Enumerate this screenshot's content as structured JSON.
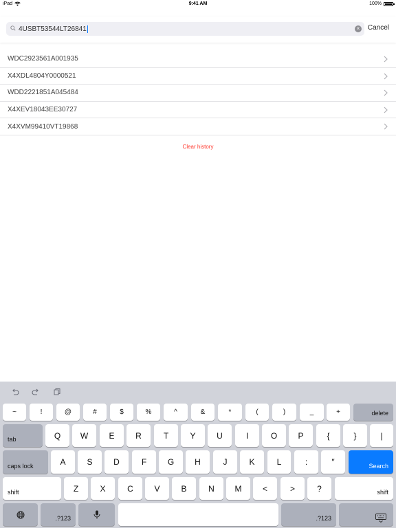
{
  "status_bar": {
    "device": "iPad",
    "time": "9:41 AM",
    "battery": "100%",
    "icons": [
      "wifi-icon",
      "battery-icon"
    ]
  },
  "search": {
    "value": "4USBT53544LT26841",
    "icon": "search-icon",
    "clear_icon": "clear-icon",
    "cancel_label": "Cancel"
  },
  "history": {
    "items": [
      {
        "label": "WDC2923561A001935"
      },
      {
        "label": "X4XDL4804Y0000521"
      },
      {
        "label": "WDD2221851A045484"
      },
      {
        "label": "X4XEV18043EE30727"
      },
      {
        "label": "X4XVM99410VT19868"
      }
    ],
    "clear_label": "Clear history",
    "accent_color": "#ff3b30"
  },
  "keyboard": {
    "toolbar_icons": [
      "undo-icon",
      "redo-icon",
      "paste-icon"
    ],
    "row1": [
      "~",
      "!",
      "@",
      "#",
      "$",
      "%",
      "^",
      "&",
      "*",
      "(",
      ")",
      "_",
      "+"
    ],
    "delete_label": "delete",
    "tab_label": "tab",
    "row2": [
      "Q",
      "W",
      "E",
      "R",
      "T",
      "Y",
      "U",
      "I",
      "O",
      "P",
      "{",
      "}",
      "|"
    ],
    "caps_label": "caps lock",
    "row3": [
      "A",
      "S",
      "D",
      "F",
      "G",
      "H",
      "J",
      "K",
      "L",
      ":",
      "″"
    ],
    "search_label": "Search",
    "search_color": "#0a7bff",
    "shift_label": "shift",
    "row4": [
      "Z",
      "X",
      "C",
      "V",
      "B",
      "N",
      "M",
      "<",
      ">",
      "?"
    ],
    "numbers_label": ".?123",
    "bottom_icons": [
      "globe-icon",
      "microphone-icon",
      "keyboard-dismiss-icon"
    ]
  }
}
